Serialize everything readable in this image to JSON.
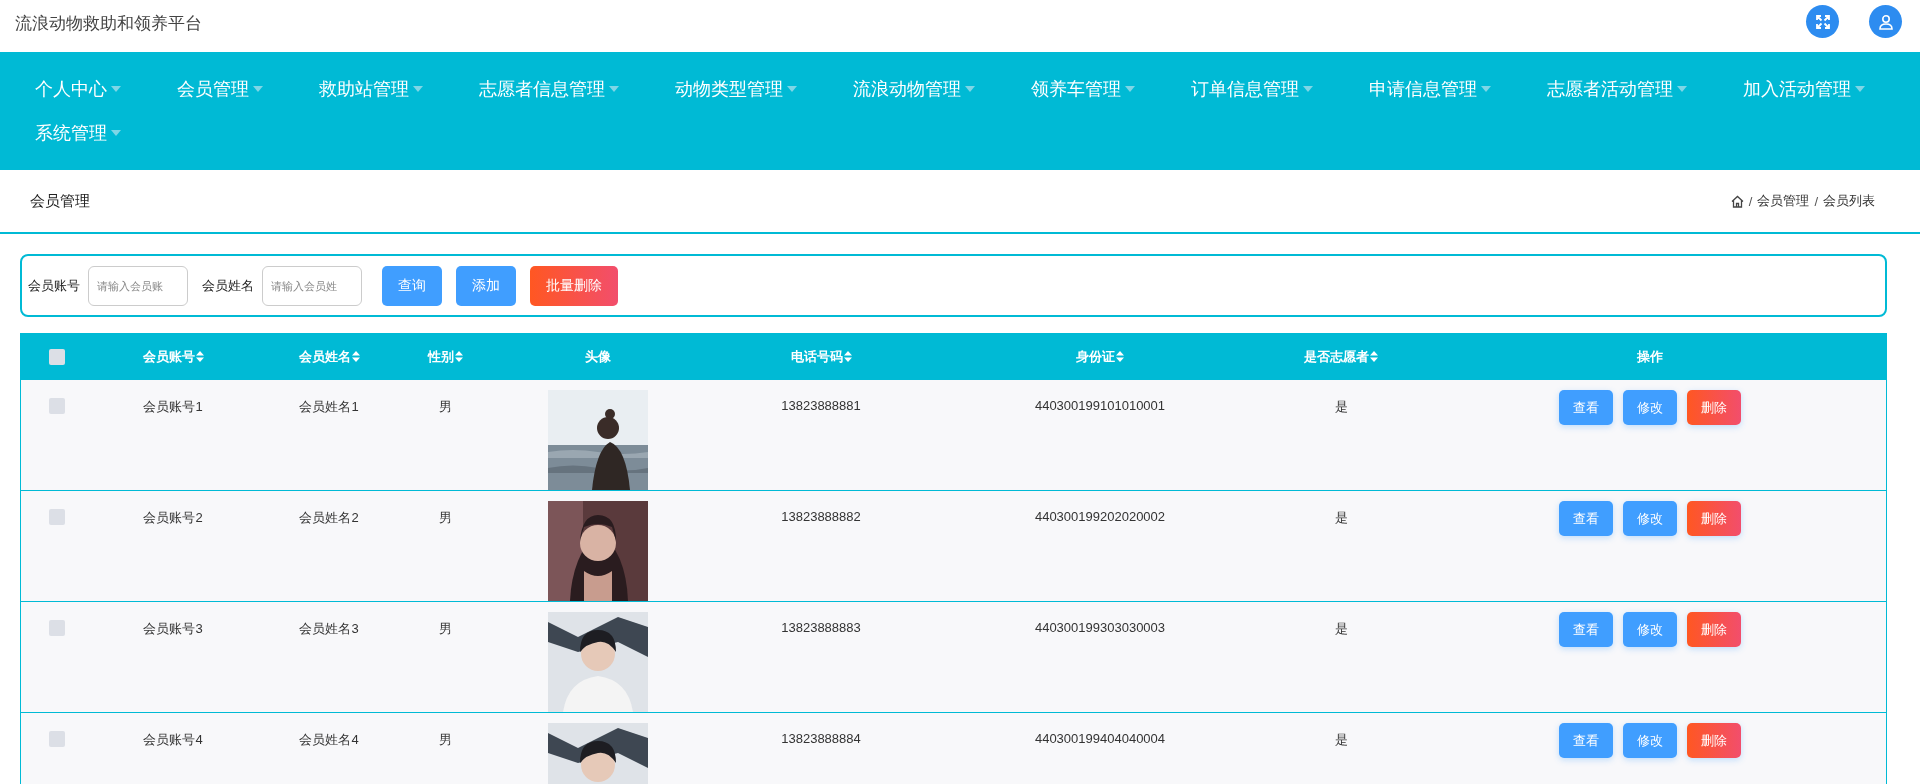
{
  "app_title": "流浪动物救助和领养平台",
  "nav": [
    {
      "label": "个人中心"
    },
    {
      "label": "会员管理"
    },
    {
      "label": "救助站管理"
    },
    {
      "label": "志愿者信息管理"
    },
    {
      "label": "动物类型管理"
    },
    {
      "label": "流浪动物管理"
    },
    {
      "label": "领养车管理"
    },
    {
      "label": "订单信息管理"
    },
    {
      "label": "申请信息管理"
    },
    {
      "label": "志愿者活动管理"
    },
    {
      "label": "加入活动管理"
    },
    {
      "label": "系统管理"
    }
  ],
  "page_title": "会员管理",
  "breadcrumb": [
    {
      "kind": "separator",
      "text": "/"
    },
    {
      "kind": "link",
      "text": "会员管理"
    },
    {
      "kind": "separator",
      "text": "/"
    },
    {
      "kind": "link",
      "text": "会员列表"
    }
  ],
  "search": {
    "fields": [
      {
        "label": "会员账号",
        "placeholder": "请输入会员账"
      },
      {
        "label": "会员姓名",
        "placeholder": "请输入会员姓"
      }
    ],
    "buttons": [
      {
        "label": "查询",
        "kind": "primary"
      },
      {
        "label": "添加",
        "kind": "primary"
      },
      {
        "label": "批量删除",
        "kind": "danger"
      }
    ]
  },
  "table": {
    "select_all": {
      "checked": false
    },
    "columns": [
      {
        "label": "会员账号",
        "sortable": true
      },
      {
        "label": "会员姓名",
        "sortable": true
      },
      {
        "label": "性别",
        "sortable": true
      },
      {
        "label": "头像",
        "sortable": false
      },
      {
        "label": "电话号码",
        "sortable": true
      },
      {
        "label": "身份证",
        "sortable": true
      },
      {
        "label": "是否志愿者",
        "sortable": true
      },
      {
        "label": "操作",
        "sortable": false
      }
    ],
    "rows": [
      {
        "checked": false,
        "cells": [
          "会员账号1",
          "会员姓名1",
          "男",
          "",
          "13823888881",
          "440300199101010001",
          "是"
        ],
        "actions": [
          {
            "label": "查看",
            "kind": "primary"
          },
          {
            "label": "修改",
            "kind": "primary"
          },
          {
            "label": "删除",
            "kind": "danger"
          }
        ]
      },
      {
        "checked": false,
        "cells": [
          "会员账号2",
          "会员姓名2",
          "男",
          "",
          "13823888882",
          "440300199202020002",
          "是"
        ],
        "actions": [
          {
            "label": "查看",
            "kind": "primary"
          },
          {
            "label": "修改",
            "kind": "primary"
          },
          {
            "label": "删除",
            "kind": "danger"
          }
        ]
      },
      {
        "checked": false,
        "cells": [
          "会员账号3",
          "会员姓名3",
          "男",
          "",
          "13823888883",
          "440300199303030003",
          "是"
        ],
        "actions": [
          {
            "label": "查看",
            "kind": "primary"
          },
          {
            "label": "修改",
            "kind": "primary"
          },
          {
            "label": "删除",
            "kind": "danger"
          }
        ]
      },
      {
        "checked": false,
        "cells": [
          "会员账号4",
          "会员姓名4",
          "男",
          "",
          "13823888884",
          "440300199404040004",
          "是"
        ],
        "actions": [
          {
            "label": "查看",
            "kind": "primary"
          },
          {
            "label": "修改",
            "kind": "primary"
          },
          {
            "label": "删除",
            "kind": "danger"
          }
        ]
      }
    ]
  }
}
